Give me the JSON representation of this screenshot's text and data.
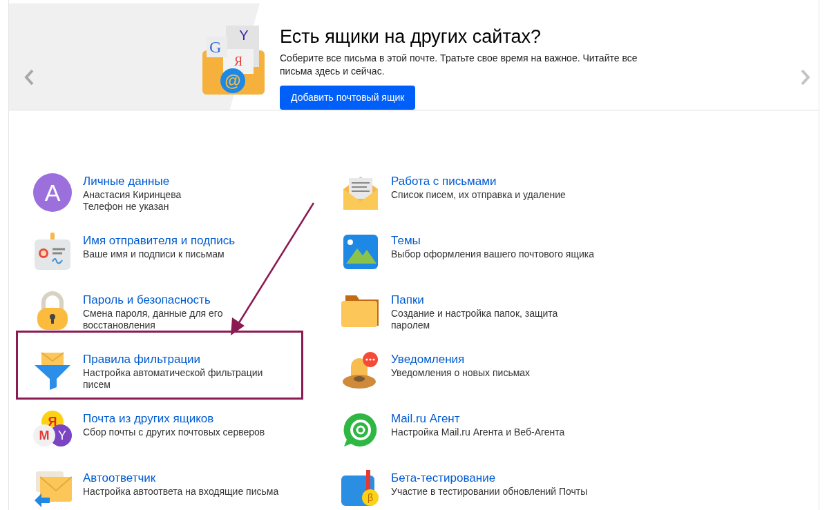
{
  "banner": {
    "title": "Есть ящики на других сайтах?",
    "text": "Соберите все письма в этой почте. Тратьте свое время на важное. Читайте все письма здесь и сейчас.",
    "button": "Добавить почтовый ящик",
    "illustration_letters": [
      "Y",
      "G",
      "Я",
      "@"
    ]
  },
  "settings": [
    {
      "title": "Личные данные",
      "lines": [
        "Анастасия Киринцева",
        "Телефон не указан"
      ],
      "highlighted": false,
      "icon_letters": [
        "A"
      ]
    },
    {
      "title": "Работа с письмами",
      "lines": [
        "Список писем, их отправка и удаление"
      ],
      "highlighted": false
    },
    {
      "title": "Имя отправителя и подпись",
      "lines": [
        "Ваше имя и подписи к письмам"
      ],
      "highlighted": false
    },
    {
      "title": "Темы",
      "lines": [
        "Выбор оформления вашего почтового ящика"
      ],
      "highlighted": false
    },
    {
      "title": "Пароль и безопасность",
      "lines": [
        "Смена пароля, данные для его",
        "восстановления"
      ],
      "highlighted": false
    },
    {
      "title": "Папки",
      "lines": [
        "Создание и настройка папок, защита",
        "паролем"
      ],
      "highlighted": false
    },
    {
      "title": "Правила фильтрации",
      "lines": [
        "Настройка автоматической фильтрации",
        "писем"
      ],
      "highlighted": true
    },
    {
      "title": "Уведомления",
      "lines": [
        "Уведомления о новых письмах"
      ],
      "highlighted": false
    },
    {
      "title": "Почта из других ящиков",
      "lines": [
        "Сбор почты с других почтовых серверов"
      ],
      "highlighted": false,
      "icon_letters": [
        "Я",
        "M",
        "Y"
      ]
    },
    {
      "title": "Mail.ru Агент",
      "lines": [
        "Настройка Mail.ru Агента и Веб-Агента"
      ],
      "highlighted": false
    },
    {
      "title": "Автоответчик",
      "lines": [
        "Настройка автоответа на входящие письма"
      ],
      "highlighted": false
    },
    {
      "title": "Бета-тестирование",
      "lines": [
        "Участие в тестировании обновлений Почты"
      ],
      "highlighted": false,
      "icon_letters": [
        "β"
      ]
    }
  ]
}
